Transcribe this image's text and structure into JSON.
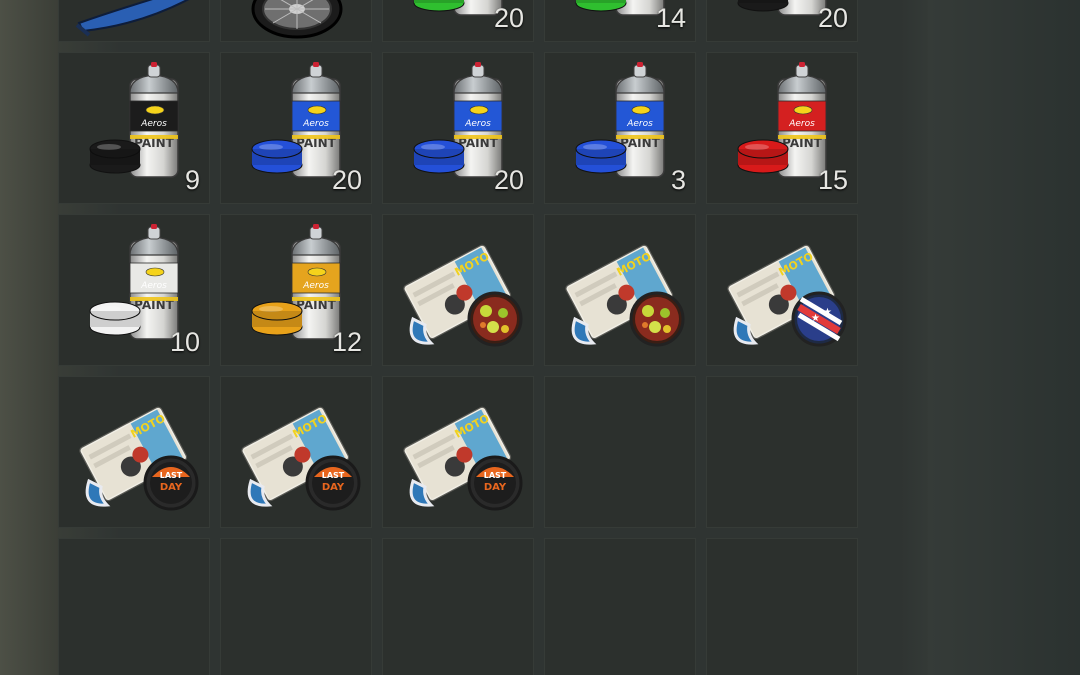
{
  "inventory": {
    "slots": [
      {
        "kind": "bike-frame",
        "icon": "motorcycle-frame-icon",
        "qty": ""
      },
      {
        "kind": "wheel",
        "icon": "tire-icon",
        "qty": ""
      },
      {
        "kind": "paint",
        "icon": "paint-can-green-icon",
        "cap_color": "#2fbf2f",
        "qty": "20"
      },
      {
        "kind": "paint",
        "icon": "paint-can-green-icon",
        "cap_color": "#2fbf2f",
        "qty": "14"
      },
      {
        "kind": "paint",
        "icon": "paint-can-black-icon",
        "cap_color": "#1a1a1a",
        "qty": "20"
      },
      {
        "kind": "paint",
        "icon": "paint-can-black-icon",
        "cap_color": "#1a1a1a",
        "label_color": "#1c1c1c",
        "qty": "9"
      },
      {
        "kind": "paint",
        "icon": "paint-can-blue-icon",
        "cap_color": "#2450d8",
        "label_color": "#2357d6",
        "qty": "20"
      },
      {
        "kind": "paint",
        "icon": "paint-can-blue-icon",
        "cap_color": "#2450d8",
        "label_color": "#2357d6",
        "qty": "20"
      },
      {
        "kind": "paint",
        "icon": "paint-can-blue-icon",
        "cap_color": "#2450d8",
        "label_color": "#2357d6",
        "qty": "3"
      },
      {
        "kind": "paint",
        "icon": "paint-can-red-icon",
        "cap_color": "#d81a1a",
        "label_color": "#d42020",
        "qty": "15"
      },
      {
        "kind": "paint",
        "icon": "paint-can-white-icon",
        "cap_color": "#f2f2f2",
        "label_color": "#e9e9e6",
        "qty": "10"
      },
      {
        "kind": "paint",
        "icon": "paint-can-yellow-icon",
        "cap_color": "#e8a21a",
        "label_color": "#e5a41e",
        "qty": "12"
      },
      {
        "kind": "magazine",
        "icon": "magazine-pattern-icon",
        "badge": "pattern",
        "qty": ""
      },
      {
        "kind": "magazine",
        "icon": "magazine-pattern-icon",
        "badge": "pattern",
        "qty": ""
      },
      {
        "kind": "magazine",
        "icon": "magazine-flag-icon",
        "badge": "flag",
        "qty": ""
      },
      {
        "kind": "magazine",
        "icon": "magazine-lastday-icon",
        "badge": "lastday",
        "badge_text": "LAST DAY",
        "qty": ""
      },
      {
        "kind": "magazine",
        "icon": "magazine-lastday-icon",
        "badge": "lastday",
        "badge_text": "LAST DAY",
        "qty": ""
      },
      {
        "kind": "magazine",
        "icon": "magazine-lastday-icon",
        "badge": "lastday",
        "badge_text": "LAST DAY",
        "qty": ""
      },
      {
        "kind": "empty",
        "icon": "",
        "qty": ""
      },
      {
        "kind": "empty",
        "icon": "",
        "qty": ""
      },
      {
        "kind": "empty",
        "icon": "",
        "qty": ""
      },
      {
        "kind": "empty",
        "icon": "",
        "qty": ""
      },
      {
        "kind": "empty",
        "icon": "",
        "qty": ""
      },
      {
        "kind": "empty",
        "icon": "",
        "qty": ""
      },
      {
        "kind": "empty",
        "icon": "",
        "qty": ""
      }
    ]
  },
  "paint_can_label": {
    "brand": "Aeros",
    "word": "PAINT"
  }
}
